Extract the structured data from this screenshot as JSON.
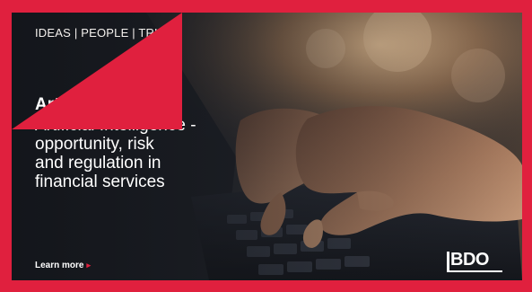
{
  "banner": {
    "tagline": "IDEAS | PEOPLE | TRUST",
    "article_type": "Article",
    "headline_lines": [
      "Artificial Intelligence -",
      "opportunity, risk",
      "and regulation in",
      "financial services"
    ],
    "cta_label": "Learn more",
    "logo_text": "BDO",
    "colors": {
      "brand_red": "#e0203e",
      "text": "#ffffff"
    },
    "icons": {
      "cta_arrow": "arrow-right-icon"
    }
  }
}
